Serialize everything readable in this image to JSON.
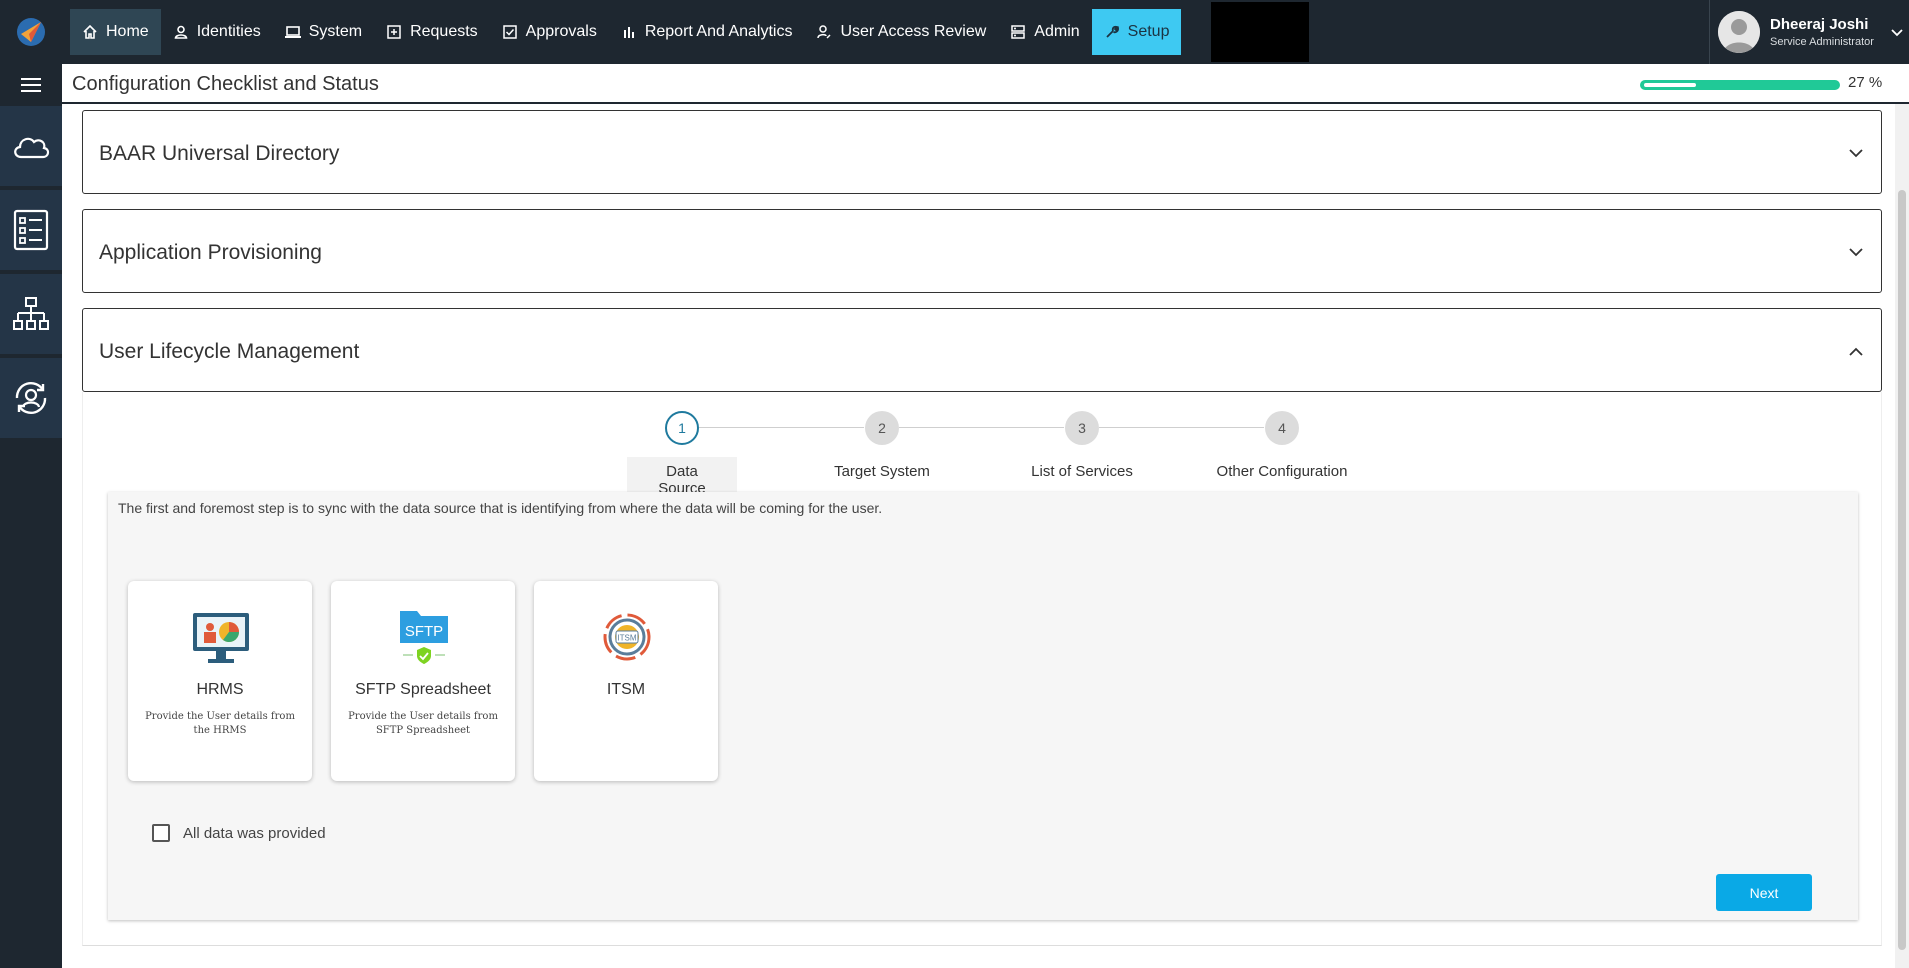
{
  "nav": {
    "items": [
      {
        "label": "Home",
        "icon": "home-icon"
      },
      {
        "label": "Identities",
        "icon": "user-icon"
      },
      {
        "label": "System",
        "icon": "laptop-icon"
      },
      {
        "label": "Requests",
        "icon": "plus-square-icon"
      },
      {
        "label": "Approvals",
        "icon": "check-square-icon"
      },
      {
        "label": "Report And Analytics",
        "icon": "bar-chart-icon"
      },
      {
        "label": "User Access Review",
        "icon": "user-edit-icon"
      },
      {
        "label": "Admin",
        "icon": "server-icon"
      },
      {
        "label": "Setup",
        "icon": "wrench-icon"
      }
    ],
    "active": "Home"
  },
  "user": {
    "name": "Dheeraj Joshi",
    "role": "Service Administrator"
  },
  "subheader": {
    "title": "Configuration Checklist and Status",
    "progress_percent": 27,
    "progress_label": "27 %"
  },
  "sections": {
    "baar": {
      "title": "BAAR Universal Directory",
      "expanded": false
    },
    "app_prov": {
      "title": "Application Provisioning",
      "expanded": false
    },
    "ulm": {
      "title": "User Lifecycle Management",
      "expanded": true
    }
  },
  "stepper": {
    "steps": [
      {
        "number": "1",
        "label": "Data Source"
      },
      {
        "number": "2",
        "label": "Target System"
      },
      {
        "number": "3",
        "label": "List of Services"
      },
      {
        "number": "4",
        "label": "Other Configuration"
      }
    ],
    "active_step": 1
  },
  "panel": {
    "description": "The first and foremost step is to sync with the data source that is identifying from where the data will be coming for the user.",
    "cards": [
      {
        "title": "HRMS",
        "desc": "Provide the User details from the HRMS",
        "icon": "hrms-monitor-icon"
      },
      {
        "title": "SFTP Spreadsheet",
        "desc": "Provide the User details from SFTP Spreadsheet",
        "icon": "sftp-folder-icon",
        "icon_text": "SFTP"
      },
      {
        "title": "ITSM",
        "desc": "",
        "icon": "itsm-gear-icon",
        "icon_text": "ITSM"
      }
    ],
    "checkbox_label": "All data was provided",
    "checkbox_checked": false,
    "next_label": "Next"
  },
  "colors": {
    "topbar": "#1e2730",
    "setup": "#3ec9f2",
    "progress": "#20c997",
    "next": "#0aa9e6",
    "step_active": "#1f7a9e"
  }
}
